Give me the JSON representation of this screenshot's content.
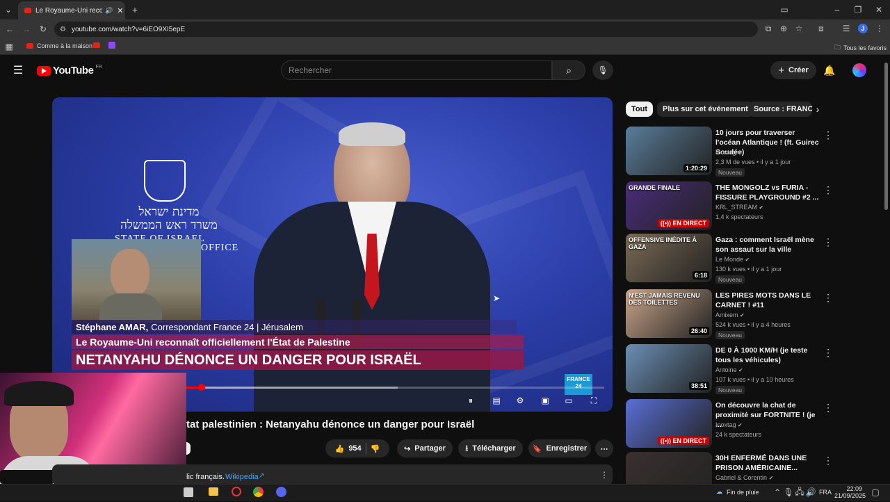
{
  "browser": {
    "tab_title": "Le Royaume-Uni reconnaît",
    "url": "youtube.com/watch?v=6iEO9XI5epE",
    "bookmarks": [
      "Comme à la maison"
    ],
    "all_bookmarks": "Tous les favoris",
    "profile_initial": "J"
  },
  "youtube": {
    "logo": "YouTube",
    "region": "FR",
    "search_placeholder": "Rechercher",
    "create_label": "Créer"
  },
  "video": {
    "hebrew_line1": "מדינת ישראל",
    "hebrew_line2": "משרד ראש הממשלה",
    "state_label": "STATE OF ISRAEL",
    "office_label": "OFFICE",
    "reporter": "Stéphane AMAR,",
    "reporter_role": "Correspondant France 24 | Jérusalem",
    "headline1": "Le Royaume-Uni reconnaît officiellement l'État de Palestine",
    "headline2": "NETANYAHU DÉNONCE UN DANGER POUR ISRAËL",
    "channel_bug": "FRANCE 24",
    "progress_fraction": 0.26,
    "buffered_fraction": 0.62
  },
  "title": "État palestinien : Netanyahu dénonce un danger pour Israël",
  "title_visible": "tat palestinien : Netanyahu dénonce un danger pour Israël",
  "actions": {
    "likes": "954",
    "share": "Partager",
    "download": "Télécharger",
    "save": "Enregistrer"
  },
  "description": {
    "text": "lic français.",
    "link": "Wikipedia"
  },
  "chips": [
    "Tout",
    "Plus sur cet événement",
    "Source : FRANC"
  ],
  "recommendations": [
    {
      "title": "10 jours pour traverser l'océan Atlantique ! (ft. Guirec Soudée)",
      "channel": "Inoxtag",
      "meta": "2,3 M de vues • il y a 1 jour",
      "badge": "Nouveau",
      "duration": "1:20:29",
      "thumb_color": "#5a7d9a"
    },
    {
      "title": "THE MONGOLZ vs FURIA - FISSURE PLAYGROUND #2 ...",
      "channel": "KRL_STREAM",
      "meta": "1,4 k spectateurs",
      "badge": "",
      "live": "EN DIRECT",
      "thumb_color": "#4a2c7a",
      "thumb_text": "GRANDE FINALE"
    },
    {
      "title": "Gaza : comment Israël mène son assaut sur la ville",
      "channel": "Le Monde",
      "meta": "130 k vues • il y a 1 jour",
      "badge": "Nouveau",
      "duration": "6:18",
      "thumb_color": "#7a6a55",
      "thumb_text": "OFFENSIVE INÉDITE À GAZA"
    },
    {
      "title": "LES PIRES MOTS DANS LE CARNET ! #11",
      "channel": "Amixem",
      "meta": "524 k vues • il y a 4 heures",
      "badge": "Nouveau",
      "duration": "26:40",
      "thumb_color": "#c9a58a",
      "thumb_text": "N'EST JAMAIS REVENU DES TOILETTES"
    },
    {
      "title": "DE 0 À 1000 KM/H (je teste tous les véhicules)",
      "channel": "Antoine",
      "meta": "107 k vues • il y a 10 heures",
      "badge": "Nouveau",
      "duration": "38:51",
      "thumb_color": "#6b8fb5"
    },
    {
      "title": "On découvre la chat de proximité sur FORTNITE ! (je ...",
      "channel": "Inoxtag",
      "meta": "24 k spectateurs",
      "badge": "",
      "live": "EN DIRECT",
      "thumb_color": "#5a6fd6"
    },
    {
      "title": "30H ENFERMÉ DANS UNE PRISON AMÉRICAINE...",
      "channel": "Gabriel & Corentin",
      "meta": "",
      "badge": "",
      "thumb_color": "#3a3030"
    }
  ],
  "taskbar": {
    "weather": "Fin de pluie",
    "lang": "FRA",
    "time": "22:09",
    "date": "21/09/2025"
  },
  "colors": {
    "accent_red": "#ff0000",
    "live_red": "#cc0000",
    "bg": "#0f0f0f"
  }
}
